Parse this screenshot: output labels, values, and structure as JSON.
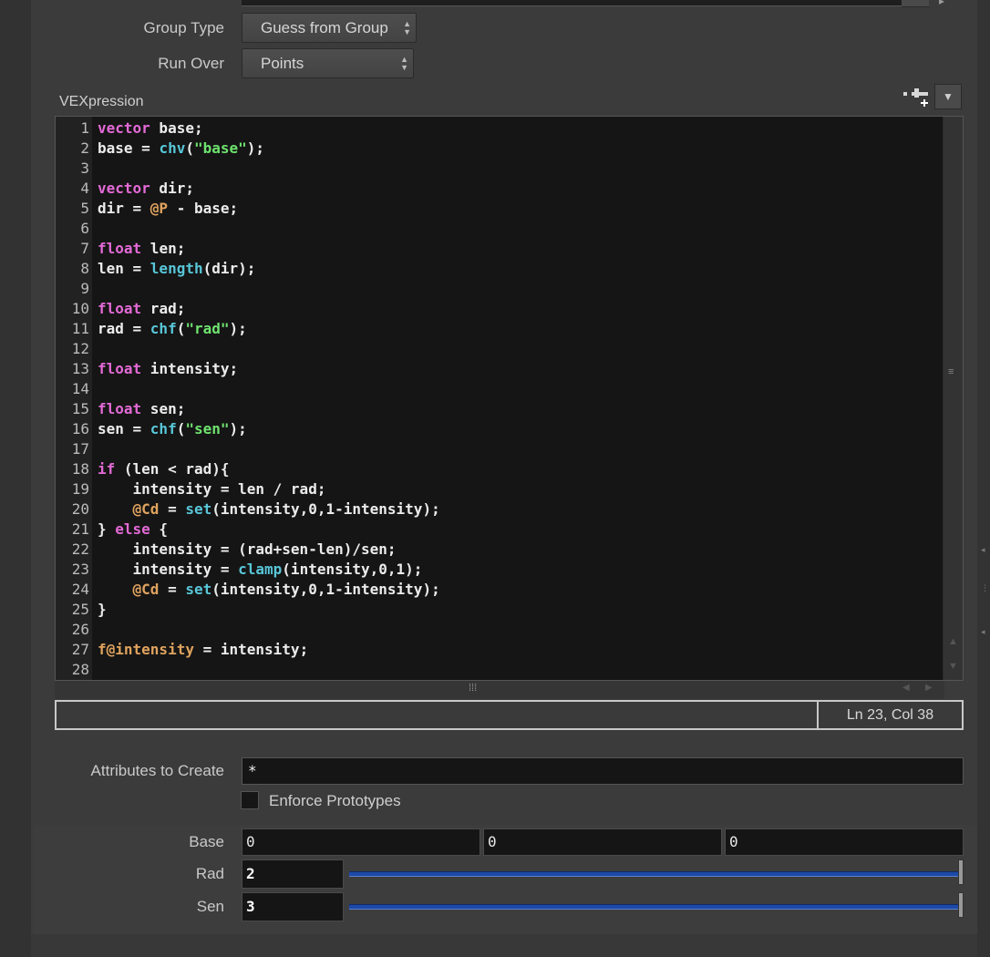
{
  "parms": {
    "group_type": {
      "label": "Group Type",
      "value": "Guess from Group"
    },
    "run_over": {
      "label": "Run Over",
      "value": "Points"
    },
    "vexpression": {
      "label": "VEXpression"
    },
    "attributes_to_create": {
      "label": "Attributes to Create",
      "value": "*"
    },
    "enforce_prototypes": {
      "label": "Enforce Prototypes",
      "checked": false
    },
    "base": {
      "label": "Base",
      "values": [
        "0",
        "0",
        "0"
      ]
    },
    "rad": {
      "label": "Rad",
      "value": "2",
      "fraction": 1.0
    },
    "sen": {
      "label": "Sen",
      "value": "3",
      "fraction": 1.0
    }
  },
  "editor": {
    "cursor_status": "Ln 23, Col 38",
    "line_numbers": [
      "1",
      "2",
      "3",
      "4",
      "5",
      "6",
      "7",
      "8",
      "9",
      "10",
      "11",
      "12",
      "13",
      "14",
      "15",
      "16",
      "17",
      "18",
      "19",
      "20",
      "21",
      "22",
      "23",
      "24",
      "25",
      "26",
      "27",
      "28"
    ],
    "lines": [
      [
        {
          "t": "kw",
          "s": "vector"
        },
        {
          "t": "plain",
          "s": " base;"
        }
      ],
      [
        {
          "t": "plain",
          "s": "base = "
        },
        {
          "t": "fn",
          "s": "chv"
        },
        {
          "t": "plain",
          "s": "("
        },
        {
          "t": "str",
          "s": "\"base\""
        },
        {
          "t": "plain",
          "s": ");"
        }
      ],
      [],
      [
        {
          "t": "kw",
          "s": "vector"
        },
        {
          "t": "plain",
          "s": " dir;"
        }
      ],
      [
        {
          "t": "plain",
          "s": "dir = "
        },
        {
          "t": "attr",
          "s": "@P"
        },
        {
          "t": "plain",
          "s": " - base;"
        }
      ],
      [],
      [
        {
          "t": "kw",
          "s": "float"
        },
        {
          "t": "plain",
          "s": " len;"
        }
      ],
      [
        {
          "t": "plain",
          "s": "len = "
        },
        {
          "t": "fn",
          "s": "length"
        },
        {
          "t": "plain",
          "s": "(dir);"
        }
      ],
      [],
      [
        {
          "t": "kw",
          "s": "float"
        },
        {
          "t": "plain",
          "s": " rad;"
        }
      ],
      [
        {
          "t": "plain",
          "s": "rad = "
        },
        {
          "t": "fn",
          "s": "chf"
        },
        {
          "t": "plain",
          "s": "("
        },
        {
          "t": "str",
          "s": "\"rad\""
        },
        {
          "t": "plain",
          "s": ");"
        }
      ],
      [],
      [
        {
          "t": "kw",
          "s": "float"
        },
        {
          "t": "plain",
          "s": " intensity;"
        }
      ],
      [],
      [
        {
          "t": "kw",
          "s": "float"
        },
        {
          "t": "plain",
          "s": " sen;"
        }
      ],
      [
        {
          "t": "plain",
          "s": "sen = "
        },
        {
          "t": "fn",
          "s": "chf"
        },
        {
          "t": "plain",
          "s": "("
        },
        {
          "t": "str",
          "s": "\"sen\""
        },
        {
          "t": "plain",
          "s": ");"
        }
      ],
      [],
      [
        {
          "t": "kw",
          "s": "if"
        },
        {
          "t": "plain",
          "s": " (len < rad){"
        }
      ],
      [
        {
          "t": "plain",
          "s": "    intensity = len / rad;"
        }
      ],
      [
        {
          "t": "plain",
          "s": "    "
        },
        {
          "t": "attr",
          "s": "@Cd"
        },
        {
          "t": "plain",
          "s": " = "
        },
        {
          "t": "fn",
          "s": "set"
        },
        {
          "t": "plain",
          "s": "(intensity,0,1-intensity);"
        }
      ],
      [
        {
          "t": "plain",
          "s": "} "
        },
        {
          "t": "kw",
          "s": "else"
        },
        {
          "t": "plain",
          "s": " {"
        }
      ],
      [
        {
          "t": "plain",
          "s": "    intensity = (rad+sen-len)/sen;"
        }
      ],
      [
        {
          "t": "plain",
          "s": "    intensity = "
        },
        {
          "t": "fn",
          "s": "clamp"
        },
        {
          "t": "plain",
          "s": "(intensity,0,1);"
        }
      ],
      [
        {
          "t": "plain",
          "s": "    "
        },
        {
          "t": "attr",
          "s": "@Cd"
        },
        {
          "t": "plain",
          "s": " = "
        },
        {
          "t": "fn",
          "s": "set"
        },
        {
          "t": "plain",
          "s": "(intensity,0,1-intensity);"
        }
      ],
      [
        {
          "t": "plain",
          "s": "}"
        }
      ],
      [],
      [
        {
          "t": "attr",
          "s": "f@intensity"
        },
        {
          "t": "plain",
          "s": " = intensity;"
        }
      ],
      []
    ]
  },
  "icons": {
    "vex_tool": "add-parameter-icon",
    "vex_menu": "chevron-down-icon",
    "dropdown": "up-down-arrows-icon"
  },
  "colors": {
    "keyword": "#e36ad6",
    "function": "#58c6d8",
    "string": "#6ee26e",
    "attribute": "#e0a35e",
    "slider": "#1d4aa8"
  }
}
